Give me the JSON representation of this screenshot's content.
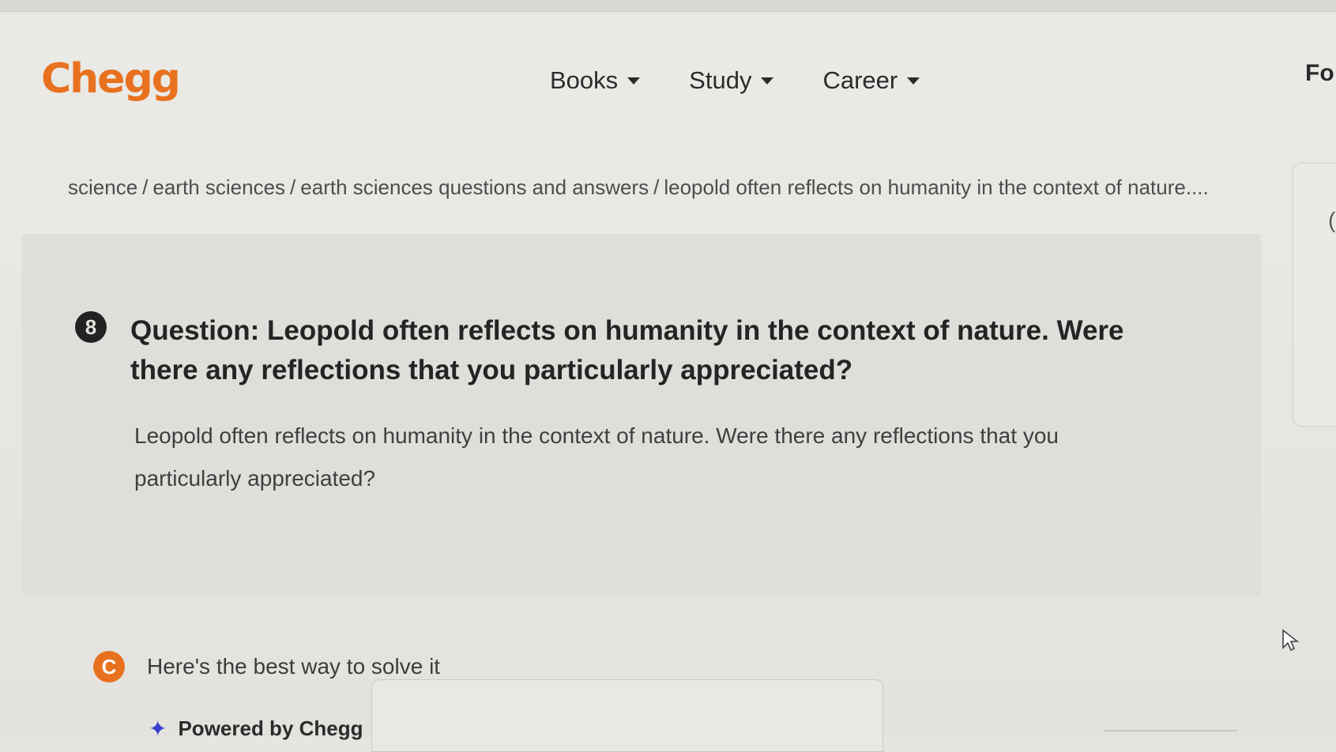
{
  "header": {
    "logo_text": "Chegg",
    "nav": [
      {
        "label": "Books"
      },
      {
        "label": "Study"
      },
      {
        "label": "Career"
      }
    ],
    "partial_text": "Fo"
  },
  "breadcrumb": {
    "items": [
      "science",
      "earth sciences",
      "earth sciences questions and answers",
      "leopold often reflects on humanity in the context of nature...."
    ],
    "separator": "/"
  },
  "question": {
    "badge": "8",
    "title": "Question: Leopold often reflects on humanity in the context of nature. Were there any reflections that you particularly appreciated?",
    "body": "Leopold often reflects on humanity in the context of nature. Were there any reflections that you particularly appreciated?"
  },
  "answer": {
    "badge": "C",
    "text": "Here's the best way to solve it",
    "powered_by": "Powered by Chegg"
  },
  "icons": {
    "nav_caret": "chevron-down-icon",
    "sparkle": "sparkle-icon",
    "cursor": "mouse-pointer-icon"
  },
  "colors": {
    "brand": "#e8711f",
    "sparkle": "#3a3fcf"
  }
}
